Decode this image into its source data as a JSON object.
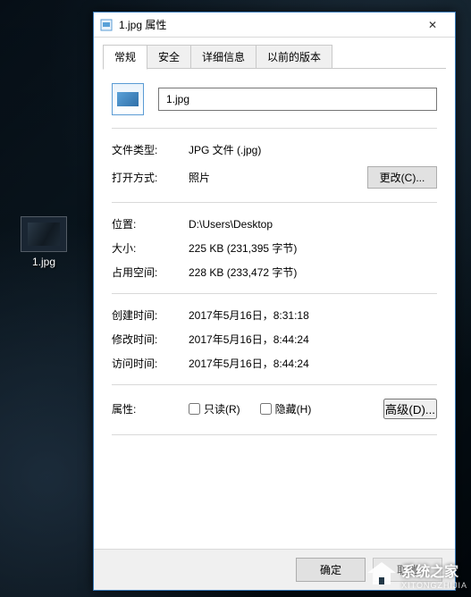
{
  "desktop": {
    "icon_label": "1.jpg"
  },
  "dialog": {
    "title": "1.jpg 属性",
    "tabs": [
      "常规",
      "安全",
      "详细信息",
      "以前的版本"
    ],
    "filename": "1.jpg",
    "file_type_label": "文件类型:",
    "file_type_value": "JPG 文件 (.jpg)",
    "open_with_label": "打开方式:",
    "open_with_value": "照片",
    "change_btn": "更改(C)...",
    "location_label": "位置:",
    "location_value": "D:\\Users\\Desktop",
    "size_label": "大小:",
    "size_value": "225 KB (231,395 字节)",
    "size_on_disk_label": "占用空间:",
    "size_on_disk_value": "228 KB (233,472 字节)",
    "created_label": "创建时间:",
    "created_value": "2017年5月16日，8:31:18",
    "modified_label": "修改时间:",
    "modified_value": "2017年5月16日，8:44:24",
    "accessed_label": "访问时间:",
    "accessed_value": "2017年5月16日，8:44:24",
    "attr_label": "属性:",
    "attr_readonly": "只读(R)",
    "attr_hidden": "隐藏(H)",
    "advanced_btn": "高级(D)...",
    "ok_btn": "确定",
    "cancel_btn": "取消"
  },
  "watermark": {
    "name": "系统之家",
    "sub": "XITONGZHIJIA"
  }
}
